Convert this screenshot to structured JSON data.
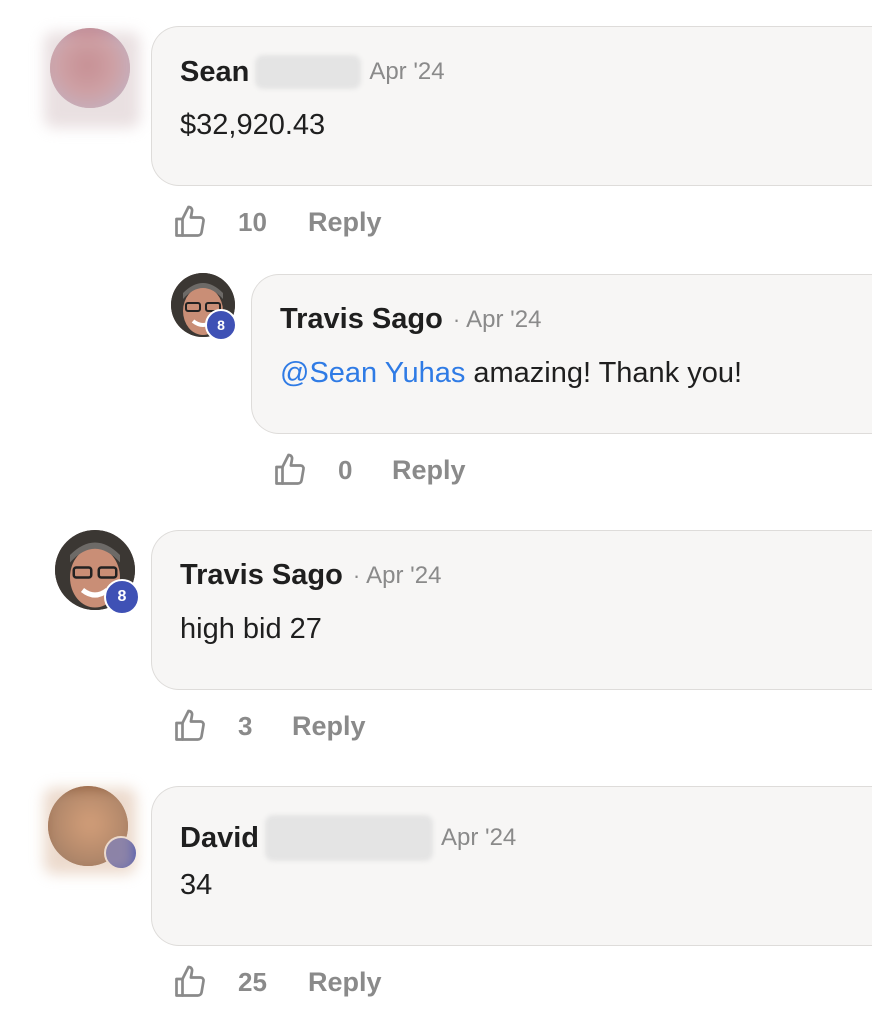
{
  "comments": [
    {
      "name": "Sean",
      "date": "Apr '24",
      "text": "$32,920.43",
      "likes": "10",
      "reply_label": "Reply"
    },
    {
      "name": "Travis Sago",
      "sep": "·",
      "date": "Apr '24",
      "mention": "@Sean Yuhas",
      "text": " amazing! Thank you!",
      "likes": "0",
      "reply_label": "Reply",
      "badge": "8"
    },
    {
      "name": "Travis Sago",
      "sep": "·",
      "date": "Apr '24",
      "text": "high bid 27",
      "likes": "3",
      "reply_label": "Reply",
      "badge": "8"
    },
    {
      "name": "David",
      "date": "Apr '24",
      "text": "34",
      "likes": "25",
      "reply_label": "Reply"
    }
  ],
  "colors": {
    "accent": "#3f51b5",
    "mention": "#2f7be5",
    "muted": "#8a8a8a",
    "bubble": "#f7f6f5"
  },
  "icons": {
    "like": "thumbs-up-icon"
  }
}
